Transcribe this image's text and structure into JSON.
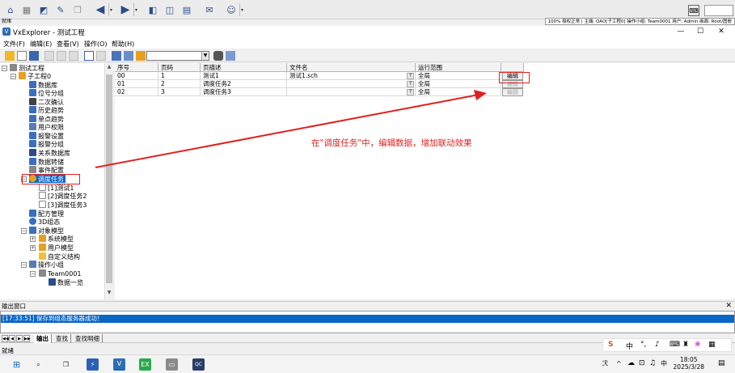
{
  "status_top": {
    "left": "就绪",
    "right": "100% 授权正常 | 主端: OAO[子工程0] 操作小组: Team0001 用户: Admin 画面: Root/图册"
  },
  "window": {
    "title": "VxExplorer - 测试工程",
    "minimize": "—",
    "maximize": "☐",
    "close": "✕"
  },
  "mdi": {
    "minimize": "—",
    "restore": "❐",
    "close": "✕"
  },
  "menu": [
    "文件(F)",
    "编辑(E)",
    "查看(V)",
    "操作(O)",
    "帮助(H)"
  ],
  "tree": {
    "root": "测试工程",
    "project": "子工程0",
    "items": [
      "数据库",
      "位号分组",
      "二次确认",
      "历史趋势",
      "单点趋势",
      "用户权限",
      "报警设置",
      "报警分组",
      "关系数据库",
      "数据转储",
      "事件配置"
    ],
    "selected": "调度任务",
    "tasks": [
      "[1]测试1",
      "[2]调度任务2",
      "[3]调度任务3"
    ],
    "after": [
      "配方管理",
      "3D组态",
      "对象模型"
    ],
    "models": [
      "系统模型",
      "用户模型",
      "自定义结构"
    ],
    "group": "操作小组",
    "team": "Team0001",
    "team_child": "数据一览"
  },
  "grid": {
    "headers": [
      "序号",
      "页码",
      "页描述",
      "文件名",
      "运行范围"
    ],
    "rows": [
      {
        "seq": "00",
        "page": "1",
        "desc": "测试1",
        "file": "测试1.sch",
        "q": "?",
        "scope": "全局",
        "edit": "编辑"
      },
      {
        "seq": "01",
        "page": "2",
        "desc": "调度任务2",
        "file": "",
        "q": "?",
        "scope": "全局",
        "edit": "编辑"
      },
      {
        "seq": "02",
        "page": "3",
        "desc": "调度任务3",
        "file": "",
        "q": "?",
        "scope": "全局",
        "edit": "编辑"
      }
    ]
  },
  "annotation": "在\"调度任务\"中，编辑数据，增加联动效果",
  "output": {
    "title": "输出窗口",
    "close": "✕",
    "line": "[17:33:51] 保存到组态服务器成功！",
    "tabs": [
      "输出",
      "查找",
      "查找明细"
    ]
  },
  "status_bottom": "就绪",
  "taskbar": {
    "time": "18:05",
    "date": "2025/3/28",
    "ime_lang": "中",
    "tray_lang": "中"
  },
  "colors": {
    "accent": "#0a66c6",
    "annotation": "#e02020"
  }
}
